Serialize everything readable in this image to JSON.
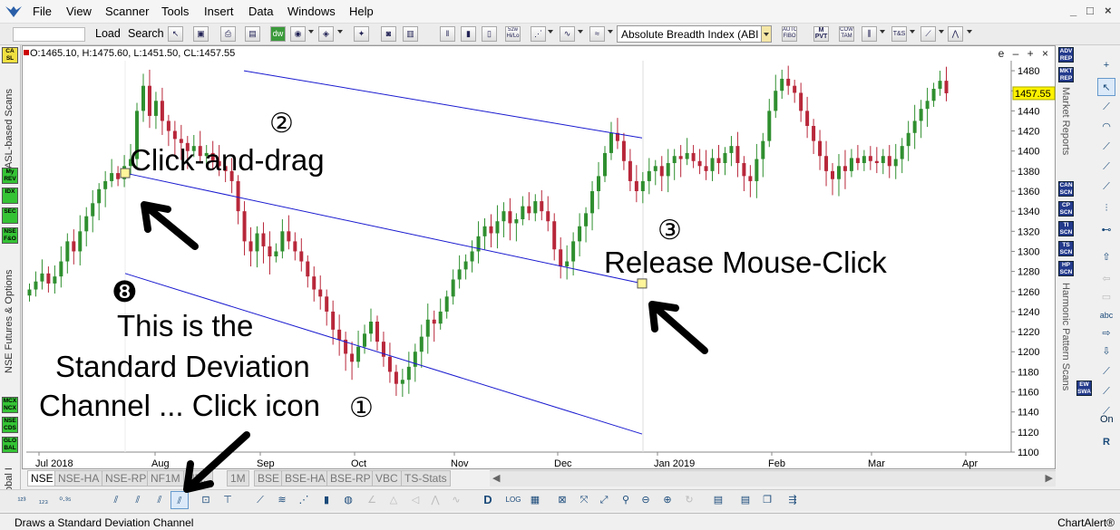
{
  "menu": {
    "items": [
      "File",
      "View",
      "Scanner",
      "Tools",
      "Insert",
      "Data",
      "Windows",
      "Help"
    ],
    "window_controls": [
      "_",
      "□",
      "×"
    ]
  },
  "toolbar": {
    "load_label": "Load",
    "search_label": "Search",
    "indicator_value": "Absolute Breadth Index (ABI",
    "icons_small": [
      "52w Hi/Lo",
      "AUTO FIBO",
      "M PVT",
      "COW TAM",
      "T&S"
    ]
  },
  "chart": {
    "ohlc_text": "O:1465.10, H:1475.60, L:1451.50, CL:1457.55",
    "controls_text": "e – + ×",
    "last_price": "1457.55",
    "y_ticks": [
      1100,
      1120,
      1140,
      1160,
      1180,
      1200,
      1220,
      1240,
      1260,
      1280,
      1300,
      1320,
      1340,
      1360,
      1380,
      1400,
      1420,
      1440,
      1460,
      1480
    ],
    "x_ticks": [
      "Jul 2018",
      "Aug",
      "Sep",
      "Oct",
      "Nov",
      "Dec",
      "Jan 2019",
      "Feb",
      "Mar",
      "Apr"
    ]
  },
  "chart_data": {
    "type": "candlestick",
    "ylim": [
      1100,
      1490
    ],
    "y_ticks": [
      1100,
      1120,
      1140,
      1160,
      1180,
      1200,
      1220,
      1240,
      1260,
      1280,
      1300,
      1320,
      1340,
      1360,
      1380,
      1400,
      1420,
      1440,
      1460,
      1480
    ],
    "x_labels": [
      "Jul 2018",
      "Aug",
      "Sep",
      "Oct",
      "Nov",
      "Dec",
      "Jan 2019",
      "Feb",
      "Mar",
      "Apr"
    ],
    "close_series": [
      1262,
      1270,
      1278,
      1268,
      1275,
      1290,
      1310,
      1300,
      1320,
      1335,
      1348,
      1362,
      1370,
      1378,
      1372,
      1385,
      1392,
      1440,
      1465,
      1435,
      1450,
      1430,
      1420,
      1412,
      1408,
      1400,
      1405,
      1395,
      1398,
      1390,
      1385,
      1380,
      1370,
      1340,
      1310,
      1300,
      1318,
      1305,
      1295,
      1300,
      1320,
      1310,
      1300,
      1290,
      1275,
      1262,
      1255,
      1240,
      1222,
      1212,
      1198,
      1190,
      1205,
      1218,
      1230,
      1210,
      1195,
      1180,
      1168,
      1172,
      1185,
      1200,
      1215,
      1232,
      1228,
      1240,
      1255,
      1272,
      1282,
      1290,
      1300,
      1315,
      1325,
      1318,
      1330,
      1340,
      1328,
      1332,
      1345,
      1338,
      1350,
      1340,
      1330,
      1302,
      1285,
      1290,
      1310,
      1325,
      1338,
      1360,
      1375,
      1398,
      1418,
      1410,
      1390,
      1370,
      1360,
      1370,
      1380,
      1385,
      1375,
      1388,
      1395,
      1392,
      1398,
      1390,
      1385,
      1380,
      1393,
      1388,
      1398,
      1405,
      1388,
      1375,
      1370,
      1392,
      1410,
      1440,
      1460,
      1472,
      1465,
      1458,
      1440,
      1425,
      1410,
      1395,
      1380,
      1372,
      1385,
      1380,
      1393,
      1388,
      1395,
      1390,
      1388,
      1395,
      1385,
      1392,
      1405,
      1418,
      1430,
      1442,
      1450,
      1462,
      1470,
      1457.55
    ],
    "ohlc_last": {
      "open": 1465.1,
      "high": 1475.6,
      "low": 1451.5,
      "close": 1457.55
    },
    "channel": {
      "middle": [
        [
          1382,
          1383
        ],
        [
          1233,
          1355
        ]
      ],
      "upper": [
        [
          1480,
          1500
        ],
        [
          1355,
          1420
        ]
      ],
      "lower": [
        [
          1280,
          1290
        ],
        [
          1140,
          1120
        ]
      ]
    }
  },
  "annotations": {
    "step2": "②",
    "click_drag": "Click-and-drag",
    "step3": "③",
    "release": "Release Mouse-Click",
    "step8": "❽",
    "line1": "This is the",
    "line2": "Standard Deviation",
    "line3": "Channel ... Click icon",
    "step1": "①"
  },
  "left_sidebar": {
    "labels": [
      "CASL-based Scans",
      "NSE Futures & Options",
      "Global I"
    ],
    "buttons": [
      "CA SL",
      "My REV",
      "IDX",
      "SEC",
      "NSE F&O",
      "MCX NCX",
      "NSE CDS",
      "GLO BAL"
    ]
  },
  "right_sidebar": {
    "labels": [
      "Market Reports",
      "Harmonic Pattern Scans"
    ],
    "buttons": [
      "ADV REP",
      "MKT REP",
      "CAN SCN",
      "CP SCN",
      "TI SCN",
      "TS SCN",
      "HP SCN",
      "EW SWA"
    ],
    "on_label": "On"
  },
  "tabs": [
    "NSE",
    "NSE-HA",
    "NSE-RP",
    "NF1M",
    "NF...",
    "1M",
    "BSE",
    "BSE-HA",
    "BSE-RP",
    "VBC",
    "TS-Stats"
  ],
  "status": {
    "left": "Draws a Standard Deviation Channel",
    "right": "ChartAlert®"
  }
}
